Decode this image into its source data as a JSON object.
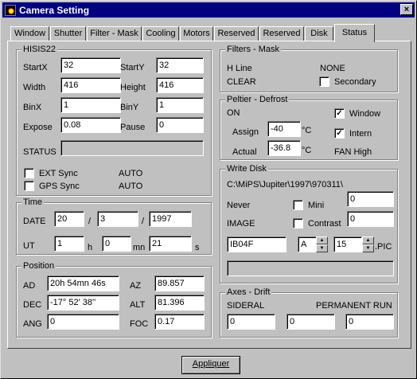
{
  "window": {
    "title": "Camera Setting",
    "close": "×",
    "apply_label": "Appliquer"
  },
  "tabs": [
    "Window",
    "Shutter",
    "Filter - Mask",
    "Cooling",
    "Motors",
    "Reserved",
    "Reserved",
    "Disk",
    "Status"
  ],
  "active_tab": "Status",
  "camera": {
    "title": "HISIS22",
    "startx_label": "StartX",
    "startx": "32",
    "starty_label": "StartY",
    "starty": "32",
    "width_label": "Width",
    "width": "416",
    "height_label": "Height",
    "height": "416",
    "binx_label": "BinX",
    "binx": "1",
    "biny_label": "BinY",
    "biny": "1",
    "expose_label": "Expose",
    "expose": "0.08",
    "pause_label": "Pause",
    "pause": "0",
    "status_label": "STATUS",
    "ext_sync_label": "EXT Sync",
    "ext_sync_value": "AUTO",
    "gps_sync_label": "GPS Sync",
    "gps_sync_value": "AUTO"
  },
  "time": {
    "title": "Time",
    "date_label": "DATE",
    "day": "20",
    "month": "3",
    "year": "1997",
    "sep": "/",
    "ut_label": "UT",
    "hours": "1",
    "h_unit": "h",
    "minutes": "0",
    "mn_unit": "mn",
    "seconds": "21",
    "s_unit": "s"
  },
  "position": {
    "title": "Position",
    "ad_label": "AD",
    "ad": "20h 54mn 46s",
    "az_label": "AZ",
    "az": "89.857",
    "dec_label": "DEC",
    "dec": "-17° 52' 38''",
    "alt_label": "ALT",
    "alt": "81.396",
    "ang_label": "ANG",
    "ang": "0",
    "foc_label": "FOC",
    "foc": "0.17"
  },
  "filters": {
    "title": "Filters - Mask",
    "hline_label": "H Line",
    "hline_value": "NONE",
    "clear_label": "CLEAR",
    "secondary_label": "Secondary"
  },
  "peltier": {
    "title": "Peltier - Defrost",
    "on_label": "ON",
    "window_label": "Window",
    "assign_label": "Assign",
    "assign": "-40",
    "unit": "°C",
    "intern_label": "Intern",
    "actual_label": "Actual",
    "actual": "-36.8",
    "fan_label": "FAN High"
  },
  "write_disk": {
    "title": "Write Disk",
    "path": "C:\\MiPS\\Jupiter\\1997\\970311\\",
    "never_label": "Never",
    "mini_label": "Mini",
    "mini_value": "0",
    "image_label": "IMAGE",
    "contrast_label": "Contrast",
    "contrast_value": "0",
    "filename": "IB04F",
    "letter": "A",
    "number": "15",
    "ext": ".PIC"
  },
  "axes": {
    "title": "Axes - Drift",
    "sideral_label": "SIDERAL",
    "permanent_label": "PERMANENT RUN",
    "v1": "0",
    "v2": "0",
    "v3": "0"
  },
  "icons": {
    "app": "camera-app-icon",
    "close": "close-icon",
    "check": "✓",
    "up": "▲",
    "down": "▼"
  }
}
